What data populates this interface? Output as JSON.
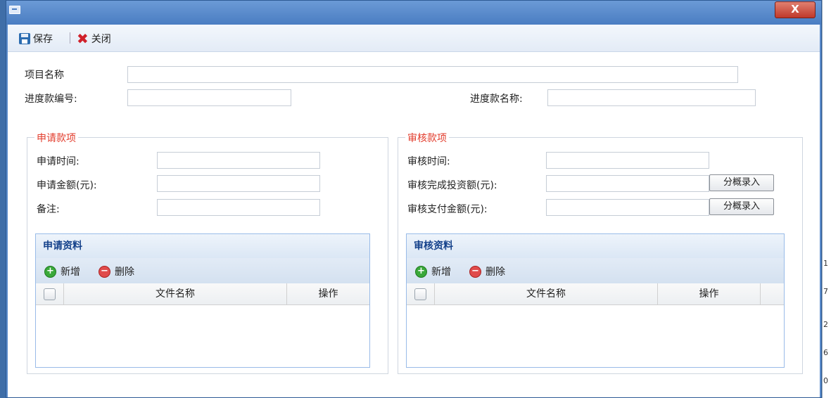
{
  "window": {
    "close_label": "X"
  },
  "toolbar": {
    "save_label": "保存",
    "close_label": "关闭"
  },
  "form": {
    "project_name_label": "项目名称",
    "progress_no_label": "进度款编号:",
    "progress_name_label": "进度款名称:",
    "project_name_value": "",
    "progress_no_value": "",
    "progress_name_value": ""
  },
  "apply": {
    "legend": "申请款项",
    "time_label": "申请时间:",
    "amount_label": "申请金额(元):",
    "remark_label": "备注:",
    "time_value": "",
    "amount_value": "",
    "remark_value": ""
  },
  "review": {
    "legend": "审核款项",
    "time_label": "审核时间:",
    "invest_label": "审核完成投资额(元):",
    "pay_label": "审核支付金额(元):",
    "split_btn1": "分概录入",
    "split_btn2": "分概录入",
    "time_value": "",
    "invest_value": "",
    "pay_value": ""
  },
  "apply_grid": {
    "title": "申请资料",
    "add": "新增",
    "delete": "删除",
    "col_file": "文件名称",
    "col_op": "操作"
  },
  "review_grid": {
    "title": "审核资料",
    "add": "新增",
    "delete": "删除",
    "col_file": "文件名称",
    "col_op": "操作"
  },
  "background_fragments": [
    "1",
    "7",
    "2",
    "6",
    "0"
  ],
  "colors": {
    "title_bar": "#4a7dc2",
    "legend": "#e23c2c",
    "grid_title": "#15428b",
    "close_button": "#c0392b"
  }
}
